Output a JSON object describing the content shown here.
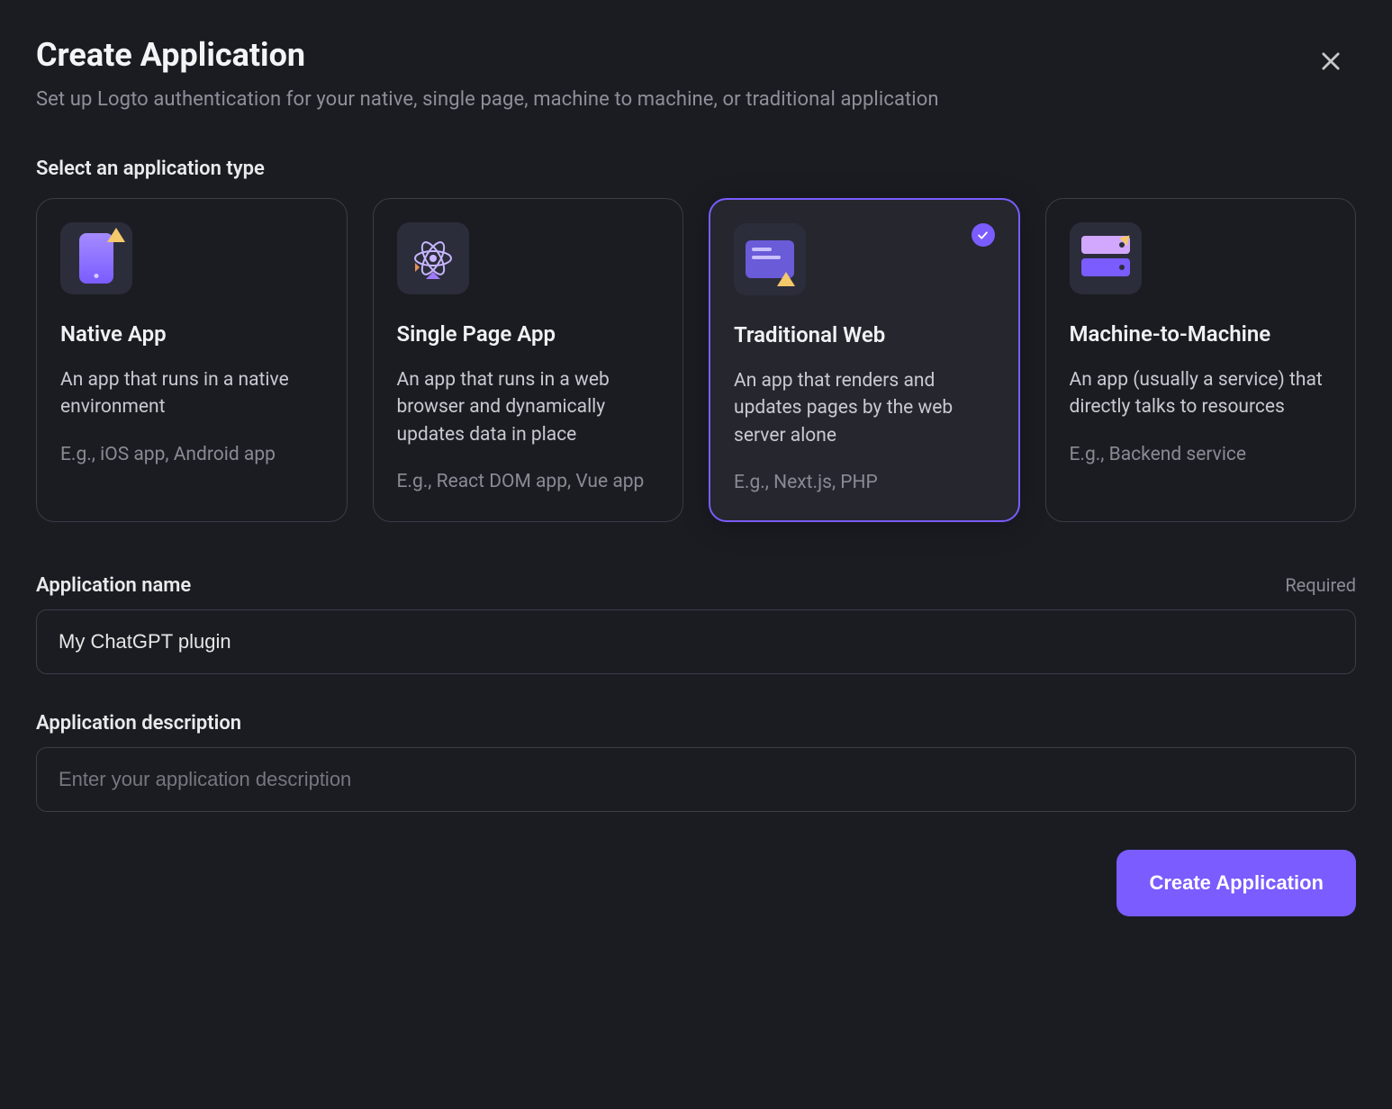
{
  "header": {
    "title": "Create Application",
    "subtitle": "Set up Logto authentication for your native, single page, machine to machine, or traditional application"
  },
  "type_section": {
    "label": "Select an application type",
    "cards": [
      {
        "icon": "native-app-icon",
        "title": "Native App",
        "description": "An app that runs in a native environment",
        "example": "E.g., iOS app, Android app",
        "selected": false
      },
      {
        "icon": "spa-icon",
        "title": "Single Page App",
        "description": "An app that runs in a web browser and dynamically updates data in place",
        "example": "E.g., React DOM app, Vue app",
        "selected": false
      },
      {
        "icon": "traditional-web-icon",
        "title": "Traditional Web",
        "description": "An app that renders and updates pages by the web server alone",
        "example": "E.g., Next.js, PHP",
        "selected": true
      },
      {
        "icon": "m2m-icon",
        "title": "Machine-to-Machine",
        "description": "An app (usually a service) that directly talks to resources",
        "example": "E.g., Backend service",
        "selected": false
      }
    ]
  },
  "form": {
    "name_label": "Application name",
    "name_required": "Required",
    "name_value": "My ChatGPT plugin",
    "description_label": "Application description",
    "description_placeholder": "Enter your application description",
    "description_value": ""
  },
  "footer": {
    "submit_label": "Create Application"
  },
  "colors": {
    "accent": "#7a5cff",
    "background": "#1a1c22",
    "border": "#3a3d46"
  }
}
